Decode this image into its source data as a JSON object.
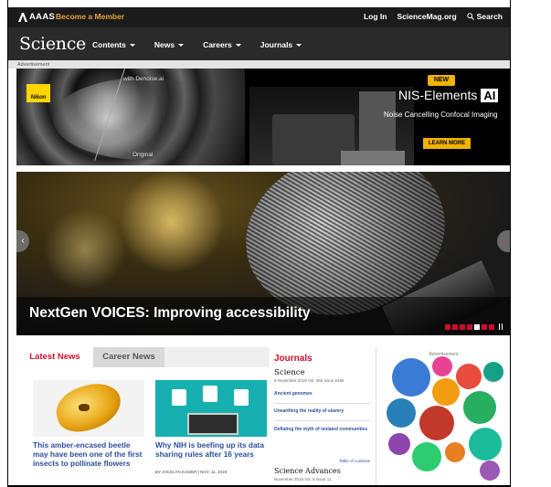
{
  "topbar": {
    "org": "AAAS",
    "member_link": "Become a Member",
    "login": "Log In",
    "sciencemag": "ScienceMag.org",
    "search": "Search"
  },
  "nav": {
    "logo": "Science",
    "items": [
      "Contents",
      "News",
      "Careers",
      "Journals"
    ]
  },
  "ad_banner": {
    "label": "Advertisement",
    "brand": "Nikon",
    "with_denoise": "with Denoise.ai",
    "original": "Original",
    "new_badge": "NEW",
    "product": "NIS-Elements",
    "product_ai": "AI",
    "tagline": "Noise Cancelling Confocal Imaging",
    "cta": "LEARN MORE"
  },
  "hero": {
    "title": "NextGen VOICES: Improving accessibility",
    "slides": 7,
    "active_slide": 4
  },
  "news": {
    "tabs": [
      "Latest News",
      "Career News"
    ],
    "stories": [
      {
        "title": "This amber-encased beetle may have been one of the first insects to pollinate flowers",
        "byline": ""
      },
      {
        "title": "Why NIH is beefing up its data sharing rules after 16 years",
        "byline": "BY JOCELYN KAISER | NOV. 11, 2019"
      }
    ]
  },
  "journals": {
    "heading": "Journals",
    "science": "Science",
    "science_issue": "8 November 2019 Vol. 366 Issue 6466",
    "links": [
      "Ancient genomes",
      "Unearthing the reality of slavery",
      "Deflating the myth of isolated communities"
    ],
    "toc": "Table of contents",
    "advances": "Science Advances",
    "advances_issue": "November 2019 Vol. 5 Issue 11"
  },
  "ad_right": {
    "label": "Advertisement"
  },
  "colors": {
    "accent_red": "#c8102e",
    "link_blue": "#2d4fa0",
    "member_orange": "#e8a13a"
  }
}
